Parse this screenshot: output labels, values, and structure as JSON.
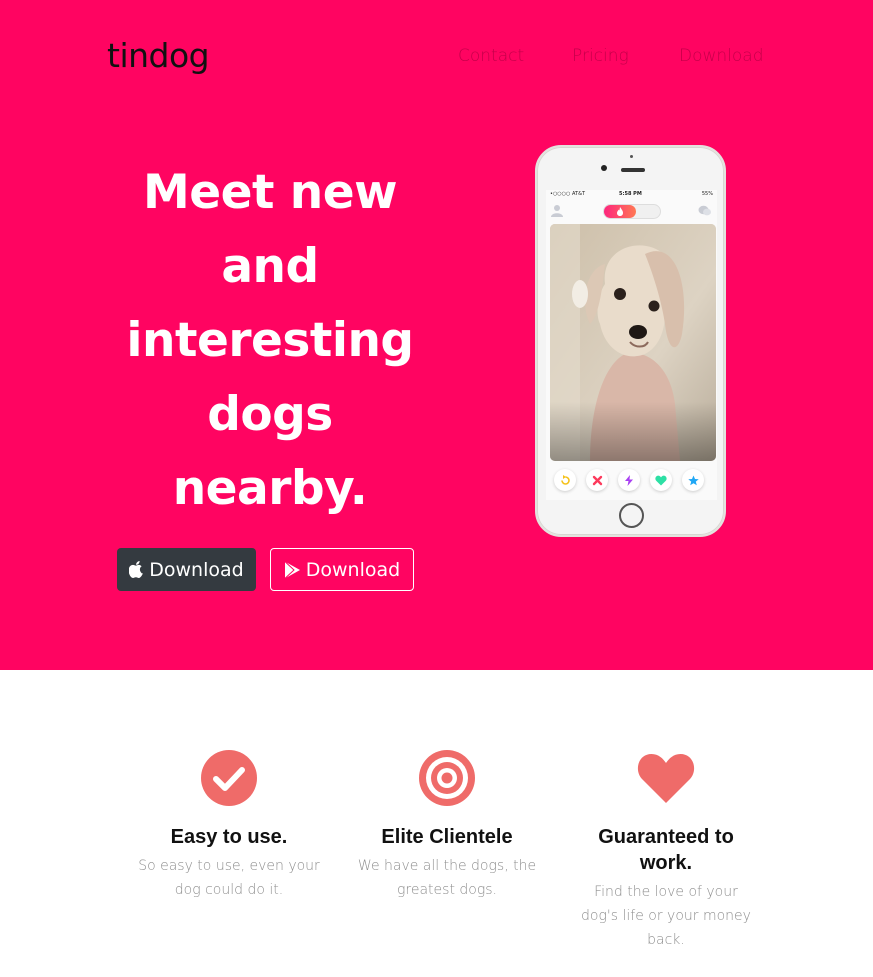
{
  "brand": {
    "name": "tindog"
  },
  "nav": {
    "items": [
      "Contact",
      "Pricing",
      "Download"
    ]
  },
  "hero": {
    "headline_lines": [
      "Meet new",
      "and",
      "interesting",
      "dogs",
      "nearby."
    ],
    "buttons": [
      {
        "label": "Download",
        "icon": "apple-icon",
        "style": "dark"
      },
      {
        "label": "Download",
        "icon": "play-store-icon",
        "style": "outline"
      }
    ]
  },
  "phone": {
    "status": {
      "carrier": "•○○○○ AT&T",
      "time": "5:58 PM",
      "battery": "55%"
    },
    "actions": [
      "rewind-icon",
      "nope-icon",
      "boost-icon",
      "like-icon",
      "superlike-icon"
    ]
  },
  "features": [
    {
      "icon": "check-circle-icon",
      "title": "Easy to use.",
      "text": "So easy to use, even your dog could do it."
    },
    {
      "icon": "bullseye-icon",
      "title": "Elite Clientele",
      "text": "We have all the dogs, the greatest dogs."
    },
    {
      "icon": "heart-icon",
      "title": "Guaranteed to work.",
      "text": "Find the love of your dog's life or your money back."
    }
  ],
  "colors": {
    "hero_bg": "#ff0461",
    "accent": "#ef6b69",
    "dark_button": "#343a40",
    "muted_text": "#8f8f8f"
  }
}
